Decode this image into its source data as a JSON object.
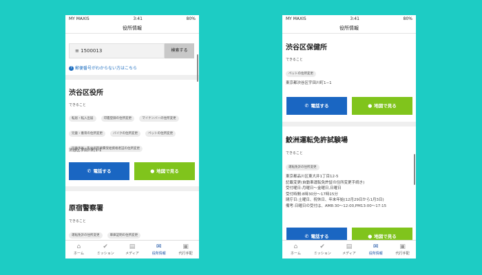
{
  "status": {
    "carrier": "MY MAXIS",
    "time": "3:41",
    "battery": "80%"
  },
  "nav": {
    "title": "役所情報"
  },
  "dekiru_label": "できること",
  "search": {
    "value": "1500013",
    "button": "検索する",
    "help": "郵便番号がわからない方はこちら"
  },
  "buttons": {
    "call": "電話する",
    "map": "地図で見る"
  },
  "tabs": [
    {
      "label": "ホーム",
      "icon": "home-icon"
    },
    {
      "label": "ミッション",
      "icon": "check-circle-icon"
    },
    {
      "label": "メディア",
      "icon": "book-icon"
    },
    {
      "label": "役所情報",
      "icon": "envelope-icon"
    },
    {
      "label": "代行手配",
      "icon": "briefcase-icon"
    }
  ],
  "active_tab": "役所情報",
  "colors": {
    "background": "#1dccc4",
    "call_button": "#1a66c2",
    "map_button": "#80c41c",
    "active_tab": "#1b53a5",
    "link": "#1f6fc0"
  },
  "left": {
    "office1": {
      "title": "渋谷区役所",
      "tags": [
        "転居・転入出届",
        "印鑑登録の住所変更",
        "マイナンバーの住所変更",
        "児童・養育の住所変更",
        "バイクの住所変更",
        "ペットの住所変更",
        "児童手当・乳幼児医療費受給資格者証の住所変更"
      ],
      "address": "渋谷区宇田川町1-1"
    },
    "office2": {
      "title": "原宿警察署",
      "tags": [
        "運転免許の住所変更",
        "車庫証明の住所変更"
      ]
    }
  },
  "right": {
    "office1": {
      "title": "渋谷区保健所",
      "tags": [
        "ペットの住所変更"
      ],
      "address": "東京都渋谷区宇田川町1−1"
    },
    "office2": {
      "title": "鮫洲運転免許試験場",
      "tags": [
        "運転免許の住所変更"
      ],
      "details": [
        "東京都品川区東大井1丁目12-5",
        "記載変更(自動車運転免許証の住所変更手続き)",
        "受付曜日:月曜日〜金曜日,日曜日",
        "受付時間:8時30分〜17時15分",
        "閉庁日:土曜日、祝休日、年末年始(12月29日から1月3日)",
        "備考:日曜日の受付は、AM8:30〜12:00,PM13:00〜17:15"
      ]
    }
  }
}
